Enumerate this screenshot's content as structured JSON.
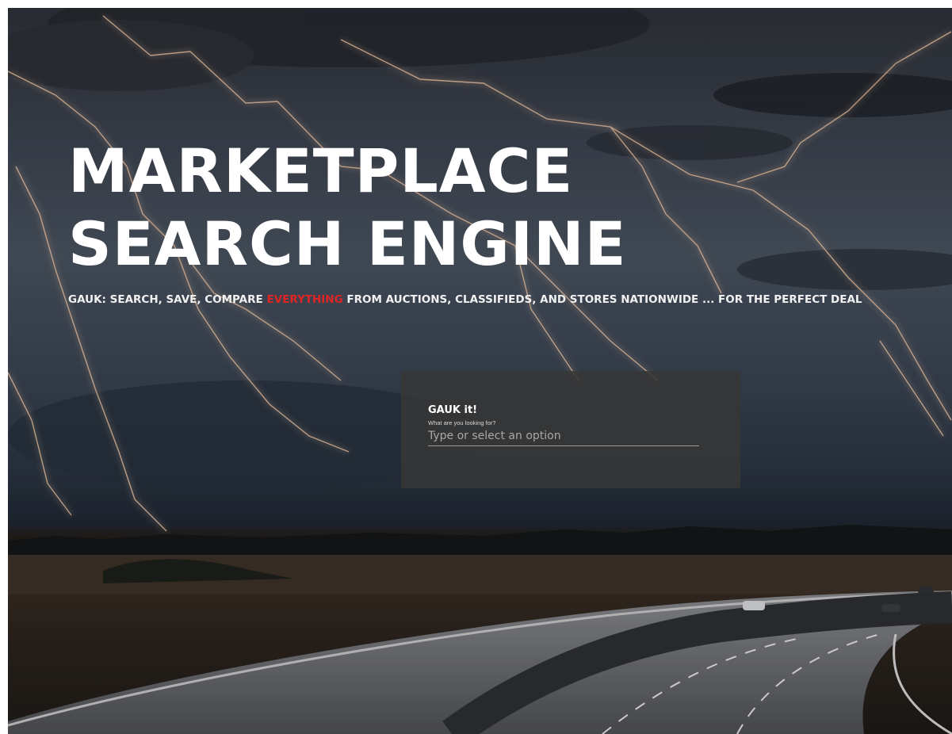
{
  "hero": {
    "title_line1": "MARKETPLACE",
    "title_line2": "SEARCH ENGINE",
    "tagline_before": "GAUK: SEARCH, SAVE, COMPARE ",
    "tagline_highlight": "EVERYTHING",
    "tagline_after": " FROM AUCTIONS, CLASSIFIEDS, AND STORES NATIONWIDE ... FOR THE PERFECT DEAL",
    "accent_color": "#e02424"
  },
  "search": {
    "card_title": "GAUK it!",
    "label": "What are you looking for?",
    "placeholder": "Type or select an option"
  }
}
